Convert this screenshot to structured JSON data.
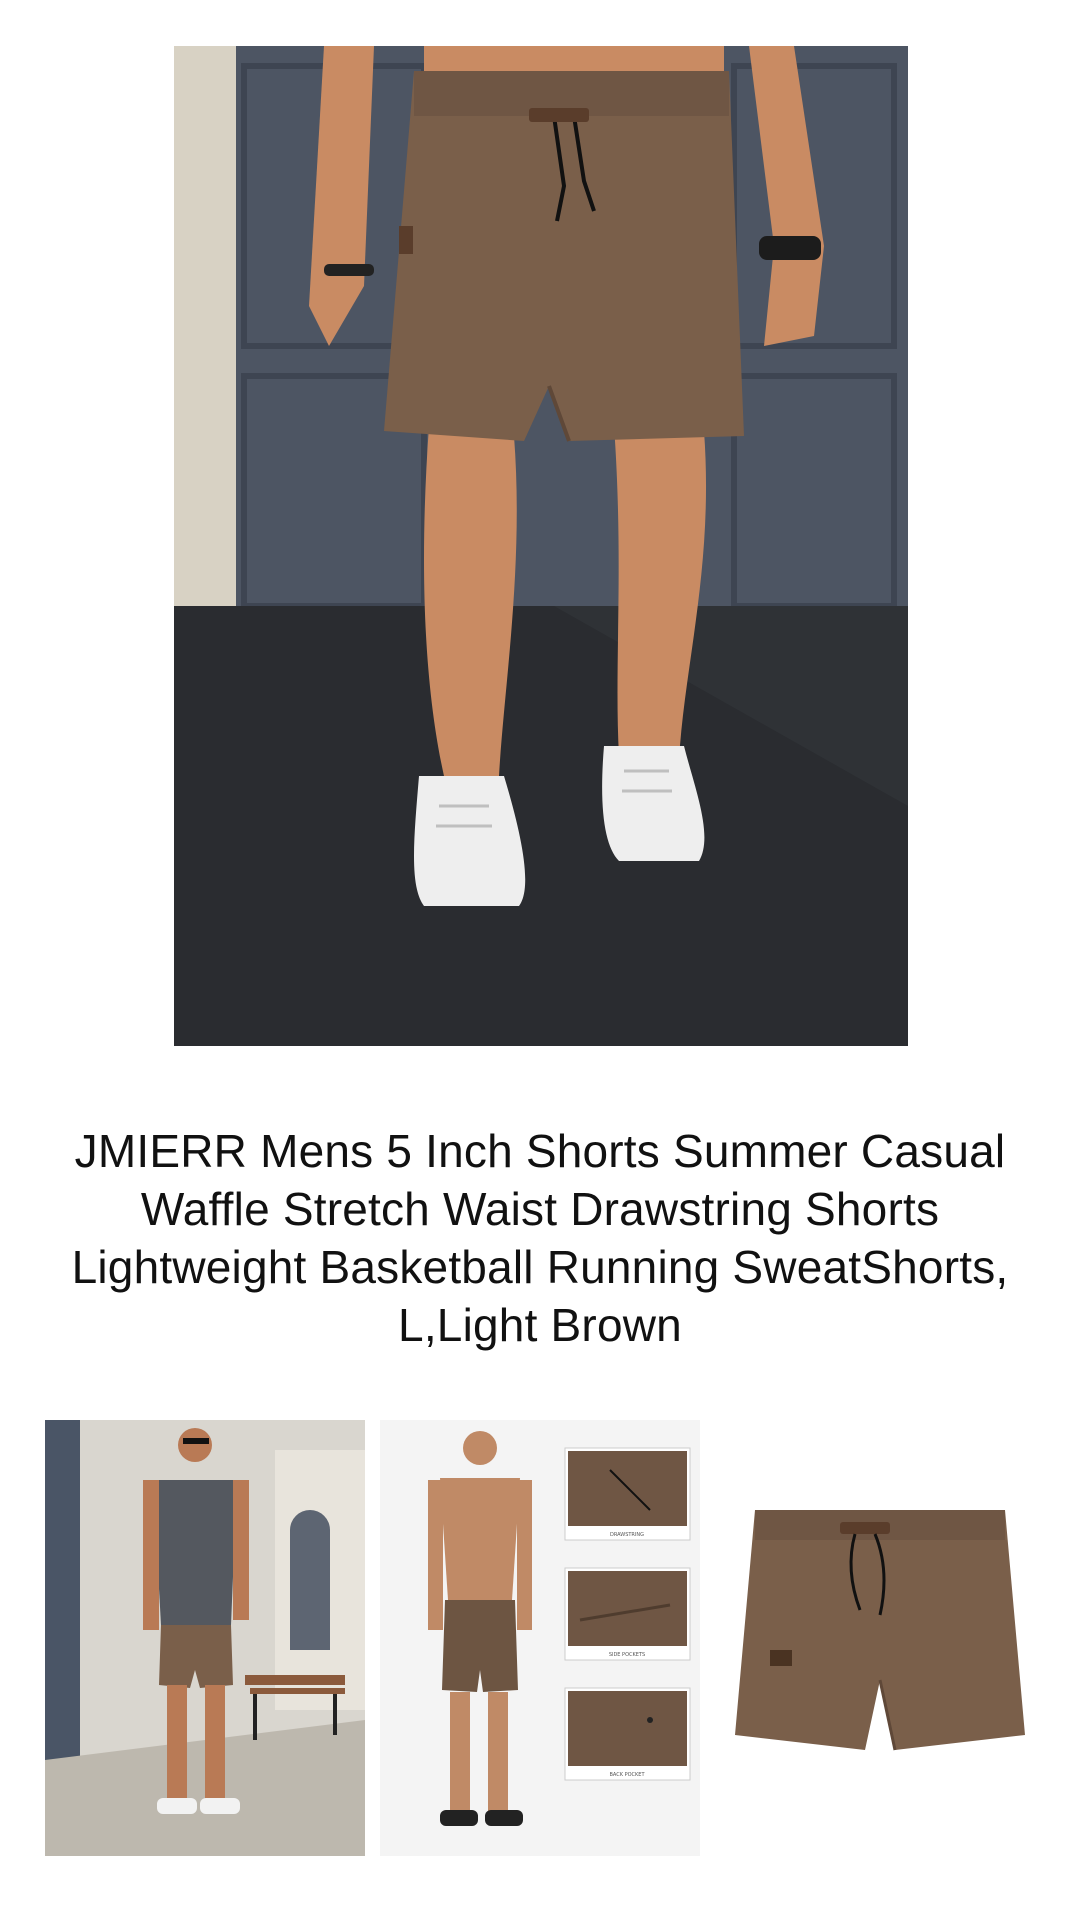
{
  "product": {
    "title": "JMIERR Mens 5 Inch Shorts Summer Casual Waffle Stretch Waist Drawstring Shorts Lightweight Basketball Running SweatShorts, L,Light Brown"
  },
  "gallery": {
    "detail_captions": {
      "drawstring": "DRAWSTRING",
      "side_pockets": "SIDE POCKETS",
      "back_pocket": "BACK POCKET"
    }
  },
  "colors": {
    "shorts": "#7a5f4a",
    "shorts_shadow": "#5f4838",
    "skin": "#c98b63",
    "wall": "#4d5563",
    "ground": "#2f3236",
    "sneaker": "#eeeeee",
    "background": "#ffffff"
  }
}
